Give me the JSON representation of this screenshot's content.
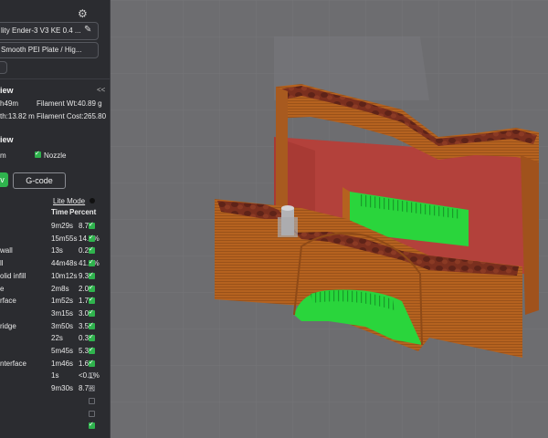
{
  "printer": {
    "name": "lity Ender-3 V3 KE 0.4 ..."
  },
  "plate": {
    "name": "Smooth PEI Plate / Hig..."
  },
  "preview": {
    "section_label": "iew",
    "time": "h49m",
    "filament_wt": "Filament Wt:40.89 g",
    "length": "th:13.82 m",
    "filament_cost": "Filament Cost:265.80",
    "collapse": "<<"
  },
  "view_section": {
    "label": "iew",
    "option_m": "m",
    "option_nozzle": "Nozzle"
  },
  "buttons": {
    "v_label": "v",
    "gcode_label": "G-code"
  },
  "lite_mode": "Lite Mode",
  "table": {
    "time_header": "Time",
    "percent_header": "Percent",
    "rows": [
      {
        "name": "",
        "time": "9m29s",
        "percent": "8.7%",
        "checked": true
      },
      {
        "name": "",
        "time": "15m55s",
        "percent": "14.6%",
        "checked": true
      },
      {
        "name": "wall",
        "time": "13s",
        "percent": "0.2%",
        "checked": true
      },
      {
        "name": "ll",
        "time": "44m48s",
        "percent": "41.0%",
        "checked": true
      },
      {
        "name": "olid infill",
        "time": "10m12s",
        "percent": "9.3%",
        "checked": true
      },
      {
        "name": "e",
        "time": "2m8s",
        "percent": "2.0%",
        "checked": true
      },
      {
        "name": "rface",
        "time": "1m52s",
        "percent": "1.7%",
        "checked": true
      },
      {
        "name": "",
        "time": "3m15s",
        "percent": "3.0%",
        "checked": true
      },
      {
        "name": "ridge",
        "time": "3m50s",
        "percent": "3.5%",
        "checked": true
      },
      {
        "name": "",
        "time": "22s",
        "percent": "0.3%",
        "checked": true
      },
      {
        "name": "",
        "time": "5m45s",
        "percent": "5.3%",
        "checked": true
      },
      {
        "name": "nterface",
        "time": "1m46s",
        "percent": "1.6%",
        "checked": true
      },
      {
        "name": "",
        "time": "1s",
        "percent": "<0.1%",
        "checked": false
      },
      {
        "name": "",
        "time": "9m30s",
        "percent": "8.7%",
        "checked": false
      },
      {
        "name": "",
        "time": "",
        "percent": "",
        "checked": false
      },
      {
        "name": "",
        "time": "",
        "percent": "",
        "checked": false
      },
      {
        "name": "",
        "time": "",
        "percent": "",
        "checked": true
      }
    ]
  },
  "colors": {
    "accent": "#2fb34d",
    "wall": "#b05f24",
    "infill": "#b53a36",
    "support": "#22d63a"
  }
}
